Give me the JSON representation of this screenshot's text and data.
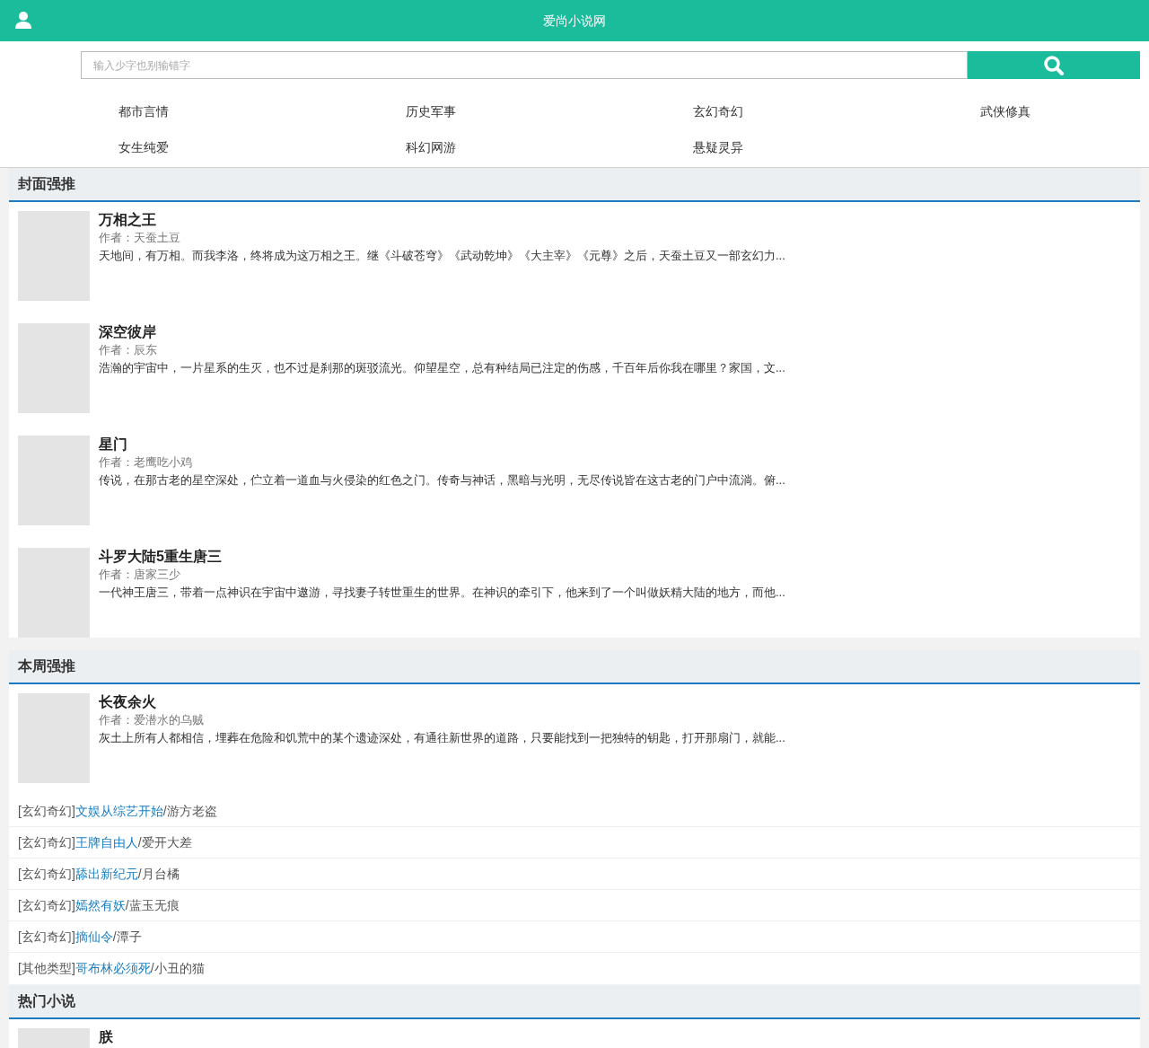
{
  "header": {
    "title": "爱尚小说网"
  },
  "search": {
    "placeholder": "输入少字也别输错字"
  },
  "categories": [
    "都市言情",
    "历史军事",
    "玄幻奇幻",
    "武侠修真",
    "女生纯爱",
    "科幻网游",
    "悬疑灵异"
  ],
  "sections": [
    {
      "title": "封面强推",
      "books": [
        {
          "title": "万相之王",
          "author": "作者：天蚕土豆",
          "description": "天地间，有万相。而我李洛，终将成为这万相之王。继《斗破苍穹》《武动乾坤》《大主宰》《元尊》之后，天蚕土豆又一部玄幻力..."
        },
        {
          "title": "深空彼岸",
          "author": "作者：辰东",
          "description": "浩瀚的宇宙中，一片星系的生灭，也不过是刹那的斑驳流光。仰望星空，总有种结局已注定的伤感，千百年后你我在哪里？家国，文..."
        },
        {
          "title": "星门",
          "author": "作者：老鹰吃小鸡",
          "description": "传说，在那古老的星空深处，伫立着一道血与火侵染的红色之门。传奇与神话，黑暗与光明，无尽传说皆在这古老的门户中流淌。俯..."
        },
        {
          "title": "斗罗大陆5重生唐三",
          "author": "作者：唐家三少",
          "description": "一代神王唐三，带着一点神识在宇宙中遨游，寻找妻子转世重生的世界。在神识的牵引下，他来到了一个叫做妖精大陆的地方，而他..."
        }
      ]
    },
    {
      "title": "本周强推",
      "books": [
        {
          "title": "长夜余火",
          "author": "作者：爱潜水的乌贼",
          "description": "灰土上所有人都相信，埋葬在危险和饥荒中的某个遗迹深处，有通往新世界的道路，只要能找到一把独特的钥匙，打开那扇门，就能..."
        }
      ],
      "links": [
        {
          "category": "[玄幻奇幻]",
          "title": "文娱从综艺开始",
          "author": "/游方老盗"
        },
        {
          "category": "[玄幻奇幻]",
          "title": "王牌自由人",
          "author": "/爱开大差"
        },
        {
          "category": "[玄幻奇幻]",
          "title": "舔出新纪元",
          "author": "/月台橘"
        },
        {
          "category": "[玄幻奇幻]",
          "title": "嫣然有妖",
          "author": "/蓝玉无痕"
        },
        {
          "category": "[玄幻奇幻]",
          "title": "摘仙令",
          "author": "/潭子"
        },
        {
          "category": "[其他类型]",
          "title": "哥布林必须死",
          "author": "/小丑的猫"
        }
      ]
    },
    {
      "title": "热门小说",
      "books": [
        {
          "title": "朕"
        }
      ]
    }
  ]
}
